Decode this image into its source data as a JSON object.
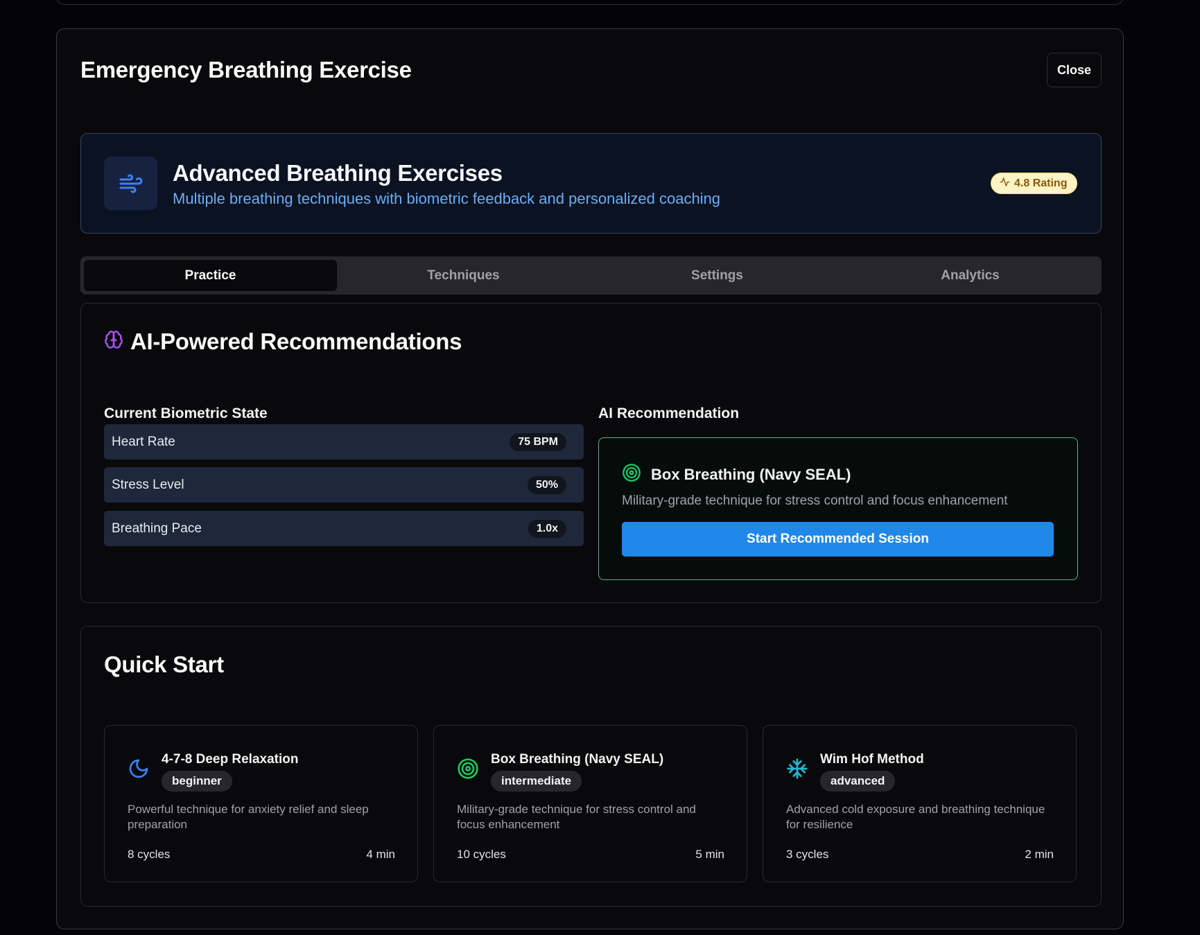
{
  "dialog": {
    "title": "Emergency Breathing Exercise",
    "close_label": "Close"
  },
  "hero": {
    "icon": "wind-icon",
    "title": "Advanced Breathing Exercises",
    "subtitle": "Multiple breathing techniques with biometric feedback and personalized coaching",
    "rating_icon": "activity-icon",
    "rating_label": "4.8 Rating"
  },
  "tabs": [
    {
      "label": "Practice",
      "active": true
    },
    {
      "label": "Techniques",
      "active": false
    },
    {
      "label": "Settings",
      "active": false
    },
    {
      "label": "Analytics",
      "active": false
    }
  ],
  "recommendations": {
    "icon": "brain-icon",
    "title": "AI-Powered Recommendations",
    "biometric_heading": "Current Biometric State",
    "metrics": [
      {
        "label": "Heart Rate",
        "value": "75 BPM"
      },
      {
        "label": "Stress Level",
        "value": "50%"
      },
      {
        "label": "Breathing Pace",
        "value": "1.0x"
      }
    ],
    "ai_heading": "AI Recommendation",
    "ai": {
      "icon": "target-icon",
      "name": "Box Breathing (Navy SEAL)",
      "description": "Military-grade technique for stress control and focus enhancement",
      "button_label": "Start Recommended Session"
    }
  },
  "quick_start": {
    "title": "Quick Start",
    "techniques": [
      {
        "icon": "moon-icon",
        "name": "4-7-8 Deep Relaxation",
        "level": "beginner",
        "description": "Powerful technique for anxiety relief and sleep preparation",
        "cycles": "8 cycles",
        "duration": "4 min"
      },
      {
        "icon": "target-icon",
        "name": "Box Breathing (Navy SEAL)",
        "level": "intermediate",
        "description": "Military-grade technique for stress control and focus enhancement",
        "cycles": "10 cycles",
        "duration": "5 min"
      },
      {
        "icon": "snowflake-icon",
        "name": "Wim Hof Method",
        "level": "advanced",
        "description": "Advanced cold exposure and breathing technique for resilience",
        "cycles": "3 cycles",
        "duration": "2 min"
      }
    ]
  },
  "colors": {
    "background": "#09090b",
    "accent_blue": "#2088e8",
    "green": "#22c55e",
    "purple": "#a855f7",
    "rating_bg": "#fdf3c4"
  }
}
